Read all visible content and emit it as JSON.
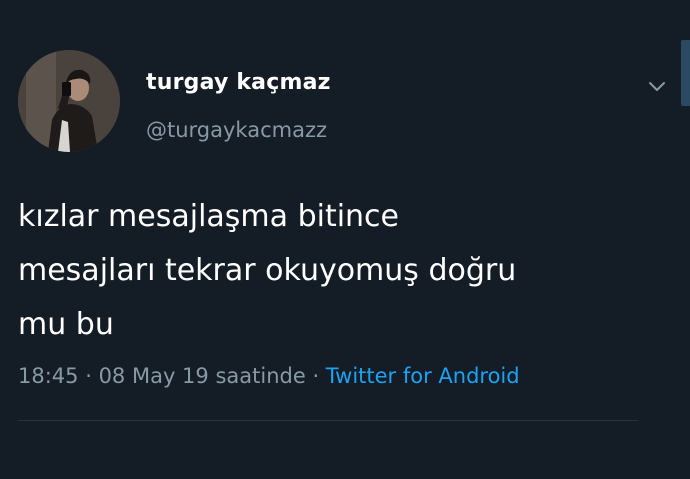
{
  "tweet": {
    "author": {
      "display_name": "turgay kaçmaz",
      "handle": "@turgaykacmazz"
    },
    "text_lines": [
      "kızlar mesajlaşma bitince",
      "mesajları tekrar okuyomuş doğru",
      "mu bu"
    ],
    "meta": {
      "time": "18:45",
      "separator1": " · ",
      "date": "08 May 19 saatinde",
      "separator2": " · ",
      "client": "Twitter for Android"
    }
  },
  "colors": {
    "background": "#141d26",
    "text_primary": "#ffffff",
    "text_secondary": "#8899a6",
    "link": "#1da1f2"
  },
  "icons": {
    "menu": "chevron-down-icon",
    "avatar": "profile-photo"
  }
}
